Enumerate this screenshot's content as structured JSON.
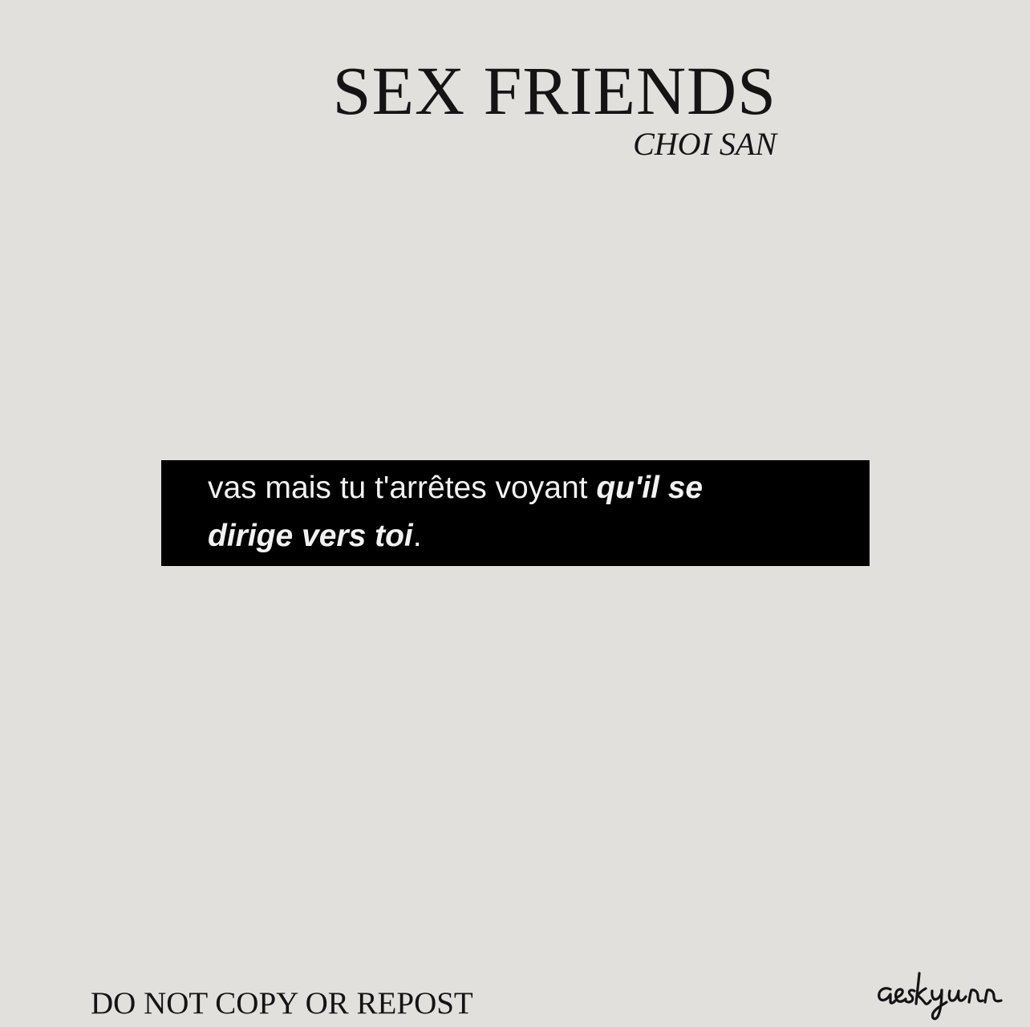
{
  "header": {
    "title": "SEX FRIENDS",
    "subtitle": "CHOI SAN"
  },
  "passage": {
    "line1_plain": "vas mais tu t'arrêtes voyant ",
    "line1_emphasis": "qu'il se",
    "line2_emphasis": "dirige vers toi",
    "line2_plain": "."
  },
  "footer": {
    "notice": "DO NOT COPY OR REPOST",
    "signature": "aeskyun"
  },
  "colors": {
    "background": "#e2e0dd",
    "text": "#141414",
    "box": "#000000",
    "box_text": "#f2f2f2"
  }
}
